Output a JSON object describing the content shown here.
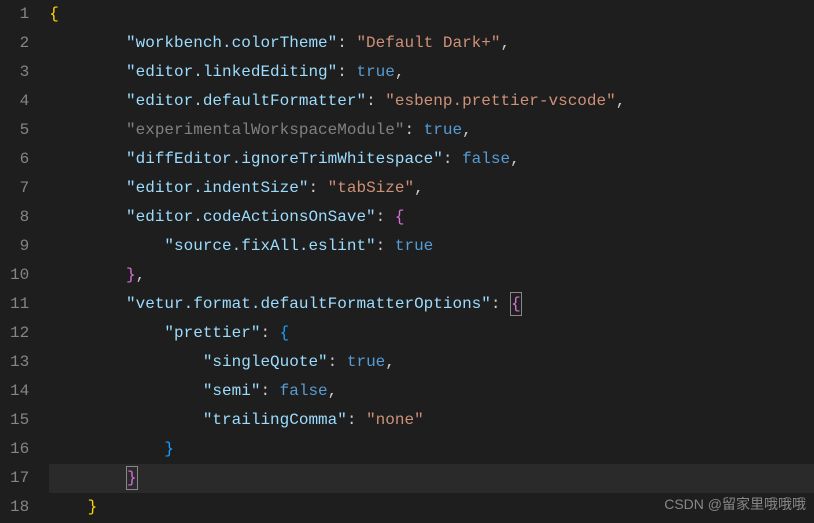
{
  "watermark": "CSDN @留家里哦哦哦",
  "lines": [
    {
      "num": "1",
      "indent": 0,
      "tokens": [
        {
          "t": "{",
          "c": "brace"
        }
      ]
    },
    {
      "num": "2",
      "indent": 2,
      "tokens": [
        {
          "t": "\"workbench.colorTheme\"",
          "c": "key"
        },
        {
          "t": ": ",
          "c": "punct"
        },
        {
          "t": "\"Default Dark+\"",
          "c": "str"
        },
        {
          "t": ",",
          "c": "punct"
        }
      ]
    },
    {
      "num": "3",
      "indent": 2,
      "tokens": [
        {
          "t": "\"editor.linkedEditing\"",
          "c": "key"
        },
        {
          "t": ": ",
          "c": "punct"
        },
        {
          "t": "true",
          "c": "bool"
        },
        {
          "t": ",",
          "c": "punct"
        }
      ]
    },
    {
      "num": "4",
      "indent": 2,
      "tokens": [
        {
          "t": "\"editor.defaultFormatter\"",
          "c": "key"
        },
        {
          "t": ": ",
          "c": "punct"
        },
        {
          "t": "\"esbenp.prettier-vscode\"",
          "c": "str"
        },
        {
          "t": ",",
          "c": "punct"
        }
      ]
    },
    {
      "num": "5",
      "indent": 2,
      "tokens": [
        {
          "t": "\"experimentalWorkspaceModule\"",
          "c": "key-dim"
        },
        {
          "t": ": ",
          "c": "punct"
        },
        {
          "t": "true",
          "c": "bool"
        },
        {
          "t": ",",
          "c": "punct"
        }
      ]
    },
    {
      "num": "6",
      "indent": 2,
      "tokens": [
        {
          "t": "\"diffEditor.ignoreTrimWhitespace\"",
          "c": "key"
        },
        {
          "t": ": ",
          "c": "punct"
        },
        {
          "t": "false",
          "c": "bool"
        },
        {
          "t": ",",
          "c": "punct"
        }
      ]
    },
    {
      "num": "7",
      "indent": 2,
      "tokens": [
        {
          "t": "\"editor.indentSize\"",
          "c": "key"
        },
        {
          "t": ": ",
          "c": "punct"
        },
        {
          "t": "\"tabSize\"",
          "c": "str"
        },
        {
          "t": ",",
          "c": "punct"
        }
      ]
    },
    {
      "num": "8",
      "indent": 2,
      "tokens": [
        {
          "t": "\"editor.codeActionsOnSave\"",
          "c": "key"
        },
        {
          "t": ": ",
          "c": "punct"
        },
        {
          "t": "{",
          "c": "brace2"
        }
      ]
    },
    {
      "num": "9",
      "indent": 3,
      "tokens": [
        {
          "t": "\"source.fixAll.eslint\"",
          "c": "key"
        },
        {
          "t": ": ",
          "c": "punct"
        },
        {
          "t": "true",
          "c": "bool"
        }
      ]
    },
    {
      "num": "10",
      "indent": 2,
      "tokens": [
        {
          "t": "}",
          "c": "brace2"
        },
        {
          "t": ",",
          "c": "punct"
        }
      ]
    },
    {
      "num": "11",
      "indent": 2,
      "tokens": [
        {
          "t": "\"vetur.format.defaultFormatterOptions\"",
          "c": "key"
        },
        {
          "t": ": ",
          "c": "punct"
        },
        {
          "t": "{",
          "c": "cursor-brace"
        }
      ]
    },
    {
      "num": "12",
      "indent": 3,
      "tokens": [
        {
          "t": "\"prettier\"",
          "c": "key"
        },
        {
          "t": ": ",
          "c": "punct"
        },
        {
          "t": "{",
          "c": "brace3"
        }
      ]
    },
    {
      "num": "13",
      "indent": 4,
      "tokens": [
        {
          "t": "\"singleQuote\"",
          "c": "key"
        },
        {
          "t": ": ",
          "c": "punct"
        },
        {
          "t": "true",
          "c": "bool"
        },
        {
          "t": ",",
          "c": "punct"
        }
      ]
    },
    {
      "num": "14",
      "indent": 4,
      "tokens": [
        {
          "t": "\"semi\"",
          "c": "key"
        },
        {
          "t": ": ",
          "c": "punct"
        },
        {
          "t": "false",
          "c": "bool"
        },
        {
          "t": ",",
          "c": "punct"
        }
      ]
    },
    {
      "num": "15",
      "indent": 4,
      "tokens": [
        {
          "t": "\"trailingComma\"",
          "c": "key"
        },
        {
          "t": ": ",
          "c": "punct"
        },
        {
          "t": "\"none\"",
          "c": "str"
        }
      ]
    },
    {
      "num": "16",
      "indent": 3,
      "tokens": [
        {
          "t": "}",
          "c": "brace3"
        }
      ]
    },
    {
      "num": "17",
      "indent": 2,
      "tokens": [
        {
          "t": "}",
          "c": "cursor-brace"
        }
      ],
      "current": true
    },
    {
      "num": "18",
      "indent": 1,
      "tokens": [
        {
          "t": "}",
          "c": "brace"
        }
      ]
    }
  ]
}
